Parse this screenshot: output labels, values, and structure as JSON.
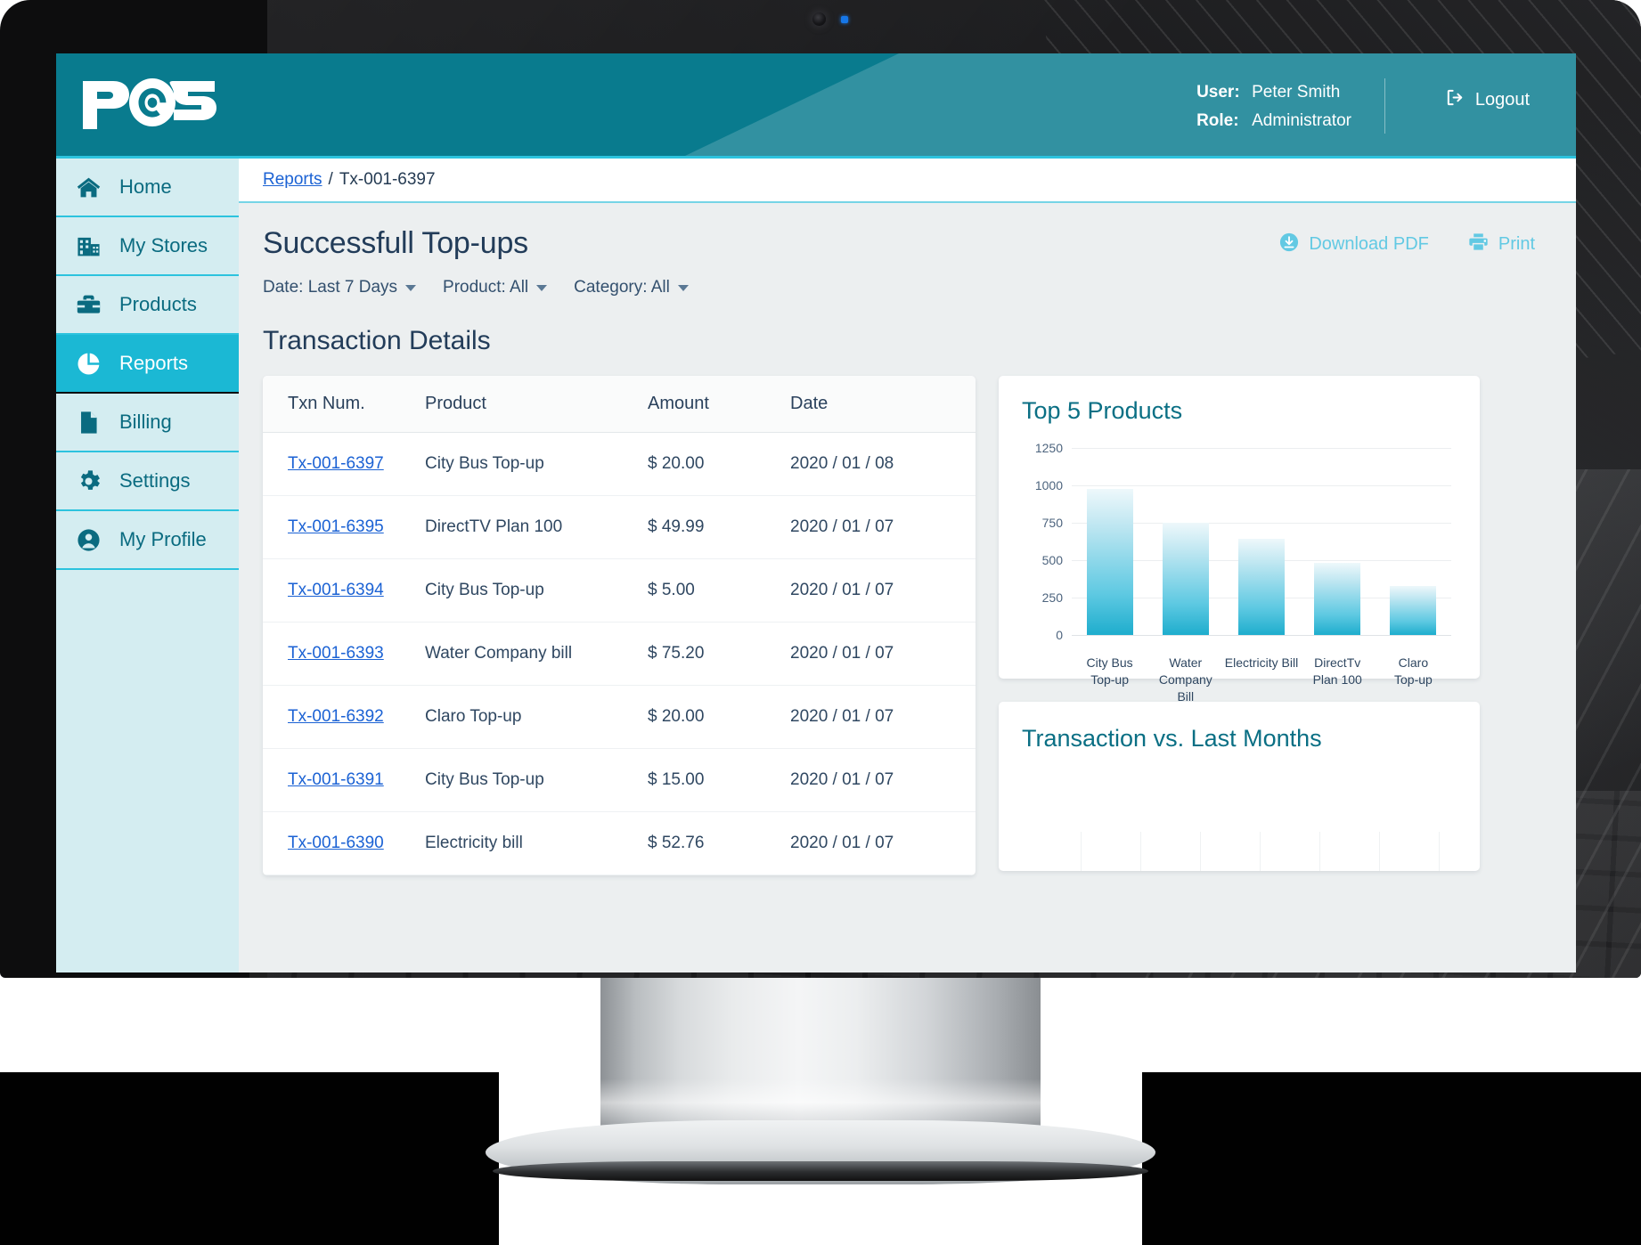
{
  "app": {
    "logo_text": "POS",
    "header": {
      "user_label": "User:",
      "user_name": "Peter Smith",
      "role_label": "Role:",
      "role_name": "Administrator",
      "logout_label": "Logout",
      "logout_icon": "sign-out-icon"
    }
  },
  "sidebar": {
    "items": [
      {
        "label": "Home",
        "icon": "home-icon",
        "active": false
      },
      {
        "label": "My Stores",
        "icon": "building-icon",
        "active": false
      },
      {
        "label": "Products",
        "icon": "toolbox-icon",
        "active": false
      },
      {
        "label": "Reports",
        "icon": "pie-chart-icon",
        "active": true
      },
      {
        "label": "Billing",
        "icon": "document-icon",
        "active": false
      },
      {
        "label": "Settings",
        "icon": "gear-icon",
        "active": false
      },
      {
        "label": "My Profile",
        "icon": "user-icon",
        "active": false
      }
    ]
  },
  "breadcrumb": {
    "root": "Reports",
    "separator": "/",
    "current": "Tx-001-6397"
  },
  "page": {
    "title": "Successfull Top-ups",
    "section_title": "Transaction Details",
    "filters": [
      {
        "label": "Date: Last 7 Days"
      },
      {
        "label": "Product: All"
      },
      {
        "label": "Category: All"
      }
    ],
    "actions": [
      {
        "label": "Download PDF",
        "icon": "download-circle-icon"
      },
      {
        "label": "Print",
        "icon": "printer-icon"
      }
    ]
  },
  "table": {
    "columns": [
      "Txn Num.",
      "Product",
      "Amount",
      "Date"
    ],
    "rows": [
      {
        "txn": "Tx-001-6397",
        "product": "City Bus Top-up",
        "amount": "$ 20.00",
        "date": "2020 / 01 / 08"
      },
      {
        "txn": "Tx-001-6395",
        "product": "DirectTV Plan 100",
        "amount": "$ 49.99",
        "date": "2020 / 01 / 07"
      },
      {
        "txn": "Tx-001-6394",
        "product": "City Bus Top-up",
        "amount": "$ 5.00",
        "date": "2020 / 01 / 07"
      },
      {
        "txn": "Tx-001-6393",
        "product": "Water Company bill",
        "amount": "$ 75.20",
        "date": "2020 / 01 / 07"
      },
      {
        "txn": "Tx-001-6392",
        "product": "Claro Top-up",
        "amount": "$ 20.00",
        "date": "2020 / 01 / 07"
      },
      {
        "txn": "Tx-001-6391",
        "product": "City Bus Top-up",
        "amount": "$ 15.00",
        "date": "2020 / 01 / 07"
      },
      {
        "txn": "Tx-001-6390",
        "product": "Electricity bill",
        "amount": "$ 52.76",
        "date": "2020 / 01 / 07"
      }
    ]
  },
  "cards": {
    "lower_title": "Transaction  vs. Last  Months"
  },
  "chart_data": {
    "type": "bar",
    "title": "Top 5 Products",
    "categories": [
      "City Bus\nTop-up",
      "Water\nCompany\nBill",
      "Electricity Bill",
      "DirectTv\nPlan 100",
      "Claro\nTop-up"
    ],
    "values": [
      975,
      750,
      645,
      485,
      330
    ],
    "ticks": [
      1250,
      1000,
      750,
      500,
      250,
      0
    ],
    "ylim": [
      0,
      1250
    ],
    "xlabel": "",
    "ylabel": "",
    "grid": true,
    "legend": "none"
  },
  "colors": {
    "brand_teal": "#097b8e",
    "accent_cyan": "#2cc3de",
    "active_nav": "#1bb8d4",
    "sidebar_bg": "#d4edf1",
    "link_blue": "#1b62d4",
    "heading_navy": "#223c59",
    "action_cyan": "#62c9e3",
    "card_title_teal": "#0a6f84"
  }
}
